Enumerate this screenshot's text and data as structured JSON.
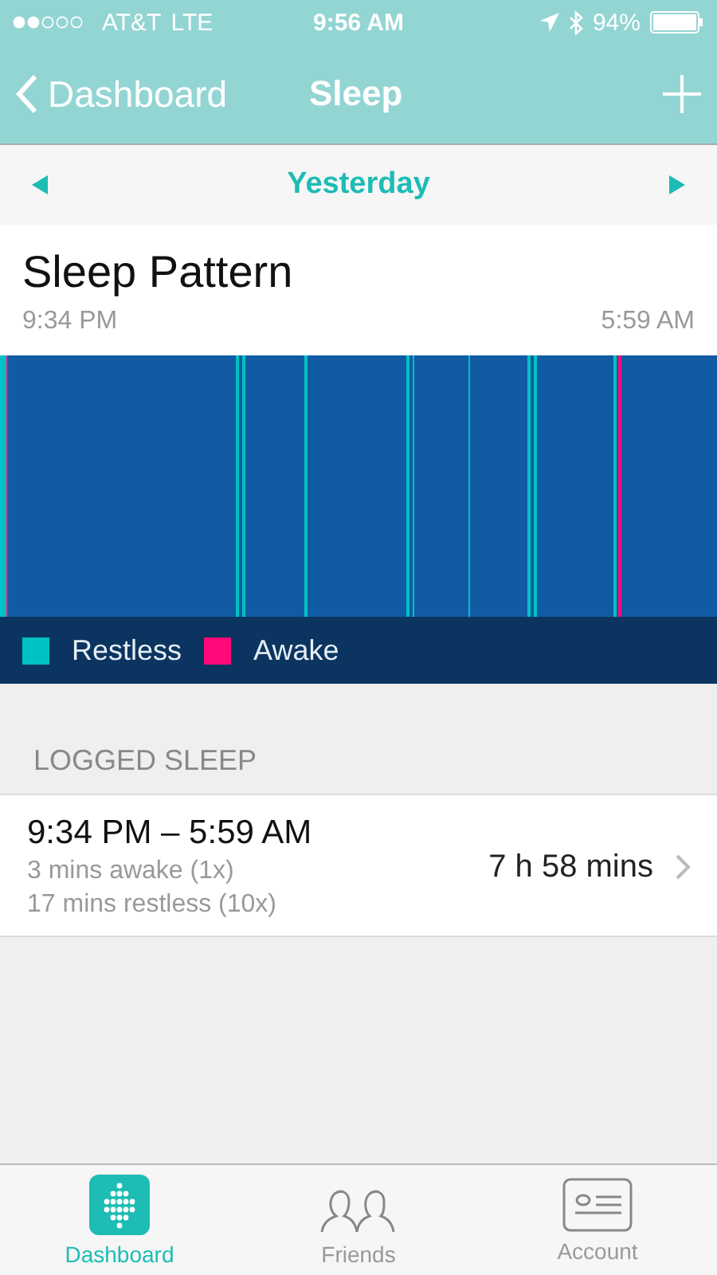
{
  "status_bar": {
    "carrier": "AT&T",
    "network": "LTE",
    "time": "9:56 AM",
    "battery": "94%"
  },
  "nav": {
    "back": "Dashboard",
    "title": "Sleep"
  },
  "date_nav": {
    "label": "Yesterday"
  },
  "pattern": {
    "title": "Sleep Pattern",
    "start": "9:34 PM",
    "end": "5:59 AM"
  },
  "legend": [
    {
      "label": "Restless",
      "color": "#00c2c2"
    },
    {
      "label": "Awake",
      "color": "#ff0a78"
    }
  ],
  "logged": {
    "header": "LOGGED SLEEP",
    "range": "9:34 PM – 5:59 AM",
    "awake": "3 mins awake (1x)",
    "restless": "17 mins restless (10x)",
    "duration": "7 h 58 mins"
  },
  "tabs": [
    {
      "label": "Dashboard",
      "selected": true
    },
    {
      "label": "Friends",
      "selected": false
    },
    {
      "label": "Account",
      "selected": false
    }
  ]
}
